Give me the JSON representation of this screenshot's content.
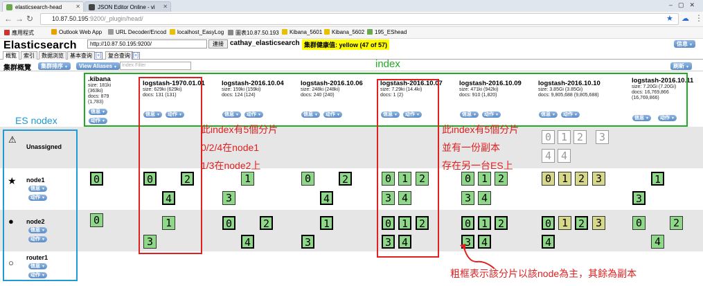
{
  "browser": {
    "tabs": [
      {
        "title": "elasticsearch-head",
        "active": true
      },
      {
        "title": "JSON Editor Online - vi",
        "active": false
      }
    ],
    "url_host": "10.87.50.195",
    "url_path": ":9200/_plugin/head/",
    "bookmarks": [
      "應用程式",
      "Outlook Web App",
      "URL Decoder/Encod",
      "localhost_EasyLog",
      "圖表10.87.50.193",
      "Kibana_5601",
      "Kibana_5602",
      "195_EShead"
    ]
  },
  "app": {
    "logo": "Elasticsearch",
    "connect_url": "http://10.87.50.195:9200/",
    "connect_label": "連接",
    "cluster_name": "cathay_elasticsearch",
    "health": "集群健康值: yellow (47 of 57)",
    "info_label": "信息",
    "tabs": [
      "概覧",
      "索引",
      "数据浏览",
      "基本查询",
      "[+]",
      "复合查询",
      "[+]"
    ],
    "overview_title": "集群概覽",
    "sort_button": "集群排序",
    "view_aliases_button": "View Aliases",
    "filter_placeholder": "Index Filter",
    "refresh_button": "刷新"
  },
  "indices": [
    {
      "name": ".kibana",
      "size": "size: 181ki",
      "size2": "(363ki)",
      "docs": "docs: 879",
      "docs2": "(1,783)"
    },
    {
      "name": "logstash-1970.01.01",
      "size": "size: 629ki (629ki)",
      "docs": "docs: 131 (131)"
    },
    {
      "name": "logstash-2016.10.04",
      "size": "size: 159ki (159ki)",
      "docs": "docs: 124 (124)"
    },
    {
      "name": "logstash-2016.10.06",
      "size": "size: 248ki (248ki)",
      "docs": "docs: 240 (240)"
    },
    {
      "name": "logstash-2016.10.07",
      "size": "size: 7.29ki (14.4ki)",
      "docs": "docs: 1 (2)"
    },
    {
      "name": "logstash-2016.10.09",
      "size": "size: 471ki (942ki)",
      "docs": "docs: 910 (1,820)"
    },
    {
      "name": "logstash-2016.10.10",
      "size": "size: 3.85Gi (3.85Gi)",
      "docs": "docs: 9,805,688 (9,805,688)"
    },
    {
      "name": "logstash-2016.10.11",
      "size": "size: 7.20Gi (7.20Gi)",
      "docs": "docs: 16,769,866",
      "docs2": "(16,769,866)"
    }
  ],
  "button_labels": {
    "info": "信息",
    "action": "动作"
  },
  "nodes": [
    {
      "name": "Unassigned",
      "icon": "warning-icon"
    },
    {
      "name": "node1",
      "icon": "star-icon"
    },
    {
      "name": "node2",
      "icon": "filled-circle-icon"
    },
    {
      "name": "router1",
      "icon": "hollow-circle-icon"
    }
  ],
  "shards": {
    "unassigned_row1": [
      "0",
      "1",
      "2",
      "3"
    ],
    "unassigned_row2": [
      "4",
      "4"
    ],
    "node1_kibana": "0",
    "node1_1970": [
      "0",
      "2",
      "4"
    ],
    "node1_1004": [
      "1",
      "3"
    ],
    "node1_1006": [
      "0",
      "2",
      "4"
    ],
    "node1_1007": [
      "0",
      "1",
      "2",
      "3",
      "4"
    ],
    "node1_1009": [
      "0",
      "1",
      "2",
      "3",
      "4"
    ],
    "node1_1010": [
      "0",
      "1",
      "2",
      "3"
    ],
    "node1_1011": [
      "1",
      "3"
    ],
    "node2_kibana": "0",
    "node2_1970": [
      "1",
      "3"
    ],
    "node2_1004": [
      "0",
      "2",
      "4"
    ],
    "node2_1006": [
      "1",
      "3"
    ],
    "node2_1007": [
      "0",
      "1",
      "2",
      "3",
      "4"
    ],
    "node2_1009": [
      "0",
      "1",
      "2",
      "3",
      "4"
    ],
    "node2_1010": [
      "0",
      "1",
      "2",
      "3",
      "4"
    ],
    "node2_1011": [
      "0",
      "2",
      "4"
    ]
  },
  "annotations": {
    "index_label": "index",
    "es_nodes_label": "ES nodex",
    "note_left": [
      "此index有5個分片",
      "0/2/4在node1",
      "1/3在node2上"
    ],
    "note_right": [
      "此index有5個分片",
      "並有一份副本",
      "存在另一台ES上"
    ],
    "note_bottom": "粗框表示該分片以該node為主，其餘為副本",
    "colors": {
      "red": "#e02020",
      "green": "#22aa22",
      "blue": "#1e9ad6"
    }
  }
}
